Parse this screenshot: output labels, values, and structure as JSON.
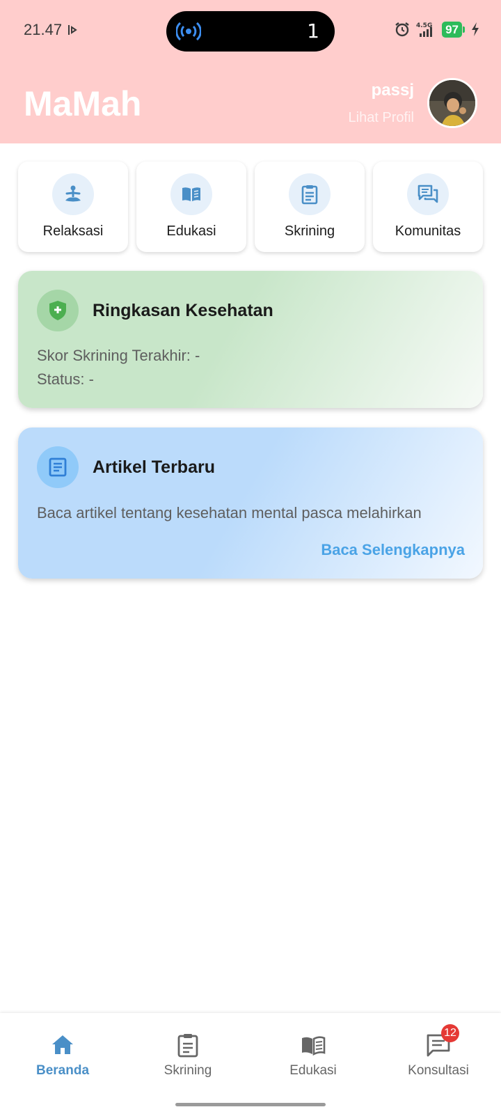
{
  "status_bar": {
    "time": "21.47",
    "live_count": "1",
    "network": "4.5G",
    "battery": "97"
  },
  "header": {
    "app_title": "MaMah",
    "username": "passj",
    "profile_link": "Lihat Profil"
  },
  "quick_menu": [
    {
      "label": "Relaksasi",
      "icon": "meditation-icon"
    },
    {
      "label": "Edukasi",
      "icon": "book-icon"
    },
    {
      "label": "Skrining",
      "icon": "clipboard-icon"
    },
    {
      "label": "Komunitas",
      "icon": "chat-icon"
    }
  ],
  "health_summary": {
    "title": "Ringkasan Kesehatan",
    "score_line": "Skor Skrining Terakhir: -",
    "status_line": "Status: -",
    "icon": "health-shield-icon"
  },
  "latest_article": {
    "title": "Artikel Terbaru",
    "description": "Baca artikel tentang kesehatan mental pasca melahirkan",
    "link": "Baca Selengkapnya",
    "icon": "article-icon"
  },
  "bottom_nav": [
    {
      "label": "Beranda",
      "icon": "home-icon",
      "active": true
    },
    {
      "label": "Skrining",
      "icon": "clipboard-icon",
      "active": false
    },
    {
      "label": "Edukasi",
      "icon": "book-icon",
      "active": false
    },
    {
      "label": "Konsultasi",
      "icon": "chat-icon",
      "active": false,
      "badge": "12"
    }
  ],
  "colors": {
    "header_bg": "#ffcdcc",
    "accent_blue": "#4a8fc7",
    "link_blue": "#4aa3e6",
    "health_green": "#4caf50",
    "badge_red": "#e53935"
  }
}
